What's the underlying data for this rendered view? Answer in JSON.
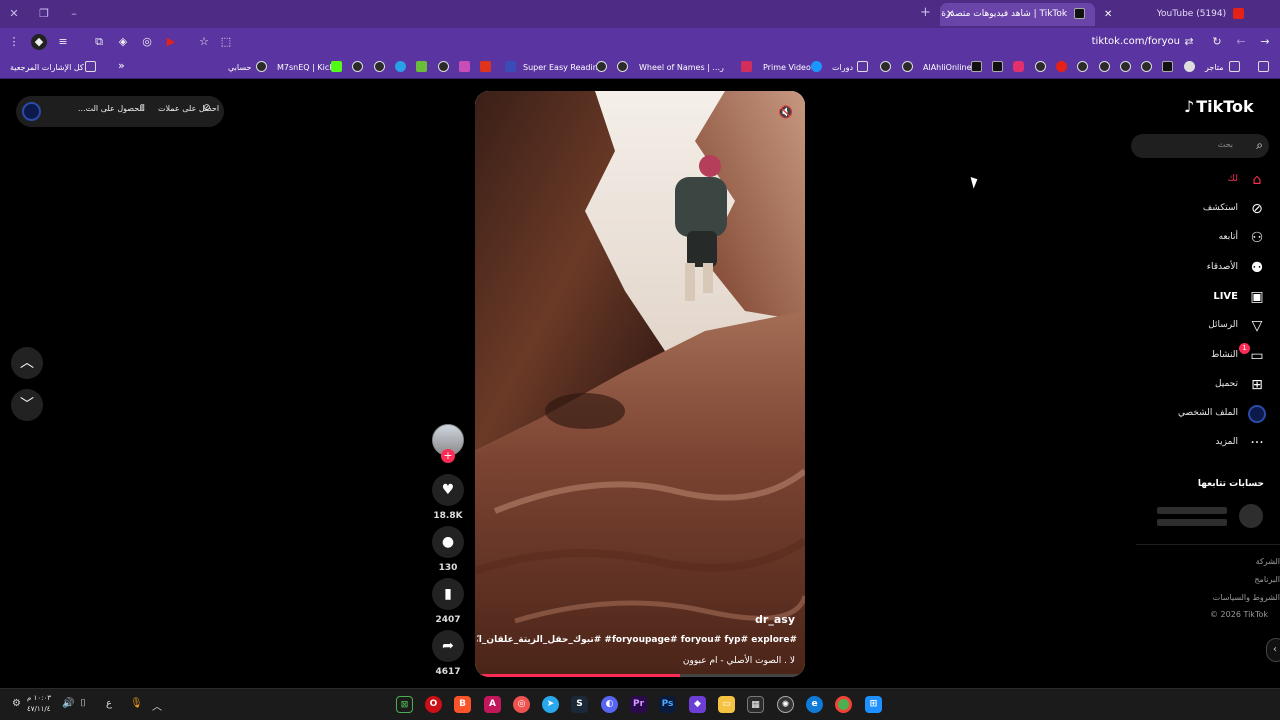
{
  "browser": {
    "tabs": [
      {
        "title": "TikTok | شاهد فيديوهات متصدرة",
        "active": true
      },
      {
        "title": "(5194) YouTube",
        "active": false
      }
    ],
    "url": "tiktok.com/foryou",
    "bookmarks": {
      "overflow": "»",
      "all_bookmarks": "كل الإشارات المرجعية",
      "items": [
        "حسابي",
        "M7snEQ | Kick",
        "Super Easy Reading",
        "Wheel of Names | ...ر",
        "Prime Video",
        "دورات",
        "AlAhliOnline",
        "متاجر"
      ]
    }
  },
  "promo": {
    "get_offers": "احصل على عملات",
    "get_app": "الحصول على الت..."
  },
  "video": {
    "username": "dr_asy",
    "description": "#foryoupage# foryou# fyp# explore# #تبوك_حقل_الزيتة_علقان_اكسبلور",
    "sound": "لا . الصوت الأصلي - ام عبوون",
    "progress": 0.62
  },
  "actions": {
    "likes": "18.8K",
    "comments": "130",
    "saves": "2407",
    "shares": "4617"
  },
  "sidebar": {
    "logo": "TikTok",
    "search_placeholder": "بحث",
    "items": [
      {
        "label": "لك",
        "icon": "home-icon"
      },
      {
        "label": "استكشف",
        "icon": "compass-icon"
      },
      {
        "label": "أتابعه",
        "icon": "following-icon"
      },
      {
        "label": "الأصدقاء",
        "icon": "friends-icon"
      },
      {
        "label": "LIVE",
        "icon": "live-icon"
      },
      {
        "label": "الرسائل",
        "icon": "messages-icon"
      },
      {
        "label": "النشاط",
        "icon": "activity-icon"
      },
      {
        "label": "تحميل",
        "icon": "upload-icon"
      },
      {
        "label": "الملف الشخصي",
        "icon": "profile-icon"
      },
      {
        "label": "المزيد",
        "icon": "more-icon"
      }
    ],
    "activity_badge": "1",
    "following_title": "حسابات تتابعها",
    "footer": [
      "الشركة",
      "البرنامج",
      "الشروط والسياسات",
      "© 2026 TikTok"
    ]
  },
  "taskbar": {
    "time": "١٠:٠٣ م",
    "date": "٤٧/١١/٤",
    "lang": "ع"
  },
  "colors": {
    "tab_bar": "#4e2c86",
    "toolbar": "#5a34a0",
    "accent": "#fe2c55"
  }
}
